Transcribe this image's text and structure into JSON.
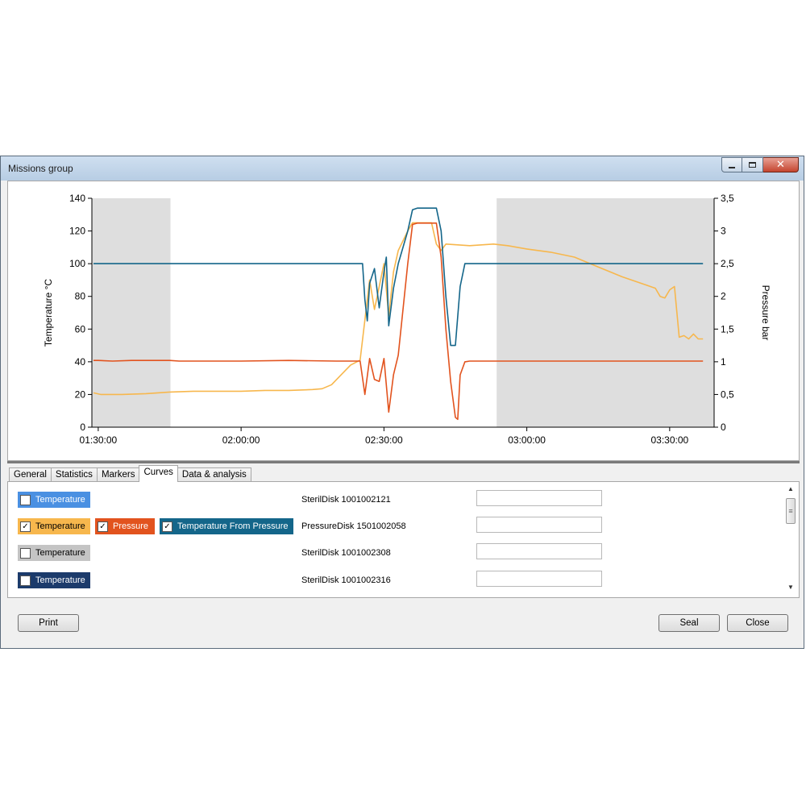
{
  "window": {
    "title": "Missions group"
  },
  "tabs": [
    "General",
    "Statistics",
    "Markers",
    "Curves",
    "Data & analysis"
  ],
  "active_tab": "Curves",
  "curve_rows": [
    {
      "curves": [
        {
          "label": "Temperature",
          "checked": false,
          "color": "#4a90e2"
        }
      ],
      "disk": "SterilDisk 1001002121",
      "value": ""
    },
    {
      "curves": [
        {
          "label": "Temperature",
          "checked": true,
          "color": "#f7b74d"
        },
        {
          "label": "Pressure",
          "checked": true,
          "color": "#e2531e"
        },
        {
          "label": "Temperature From Pressure",
          "checked": true,
          "color": "#14668a"
        }
      ],
      "disk": "PressureDisk 1501002058",
      "value": ""
    },
    {
      "curves": [
        {
          "label": "Temperature",
          "checked": false,
          "color": "#c4c4c4"
        }
      ],
      "disk": "SterilDisk 1001002308",
      "value": ""
    },
    {
      "curves": [
        {
          "label": "Temperature",
          "checked": false,
          "color": "#1c3b6b"
        }
      ],
      "disk": "SterilDisk 1001002316",
      "value": ""
    }
  ],
  "buttons": {
    "print": "Print",
    "seal": "Seal",
    "close": "Close"
  },
  "chart_data": {
    "type": "line",
    "title": "",
    "ylabel": "Temperature °C",
    "y2label": "Pressure bar",
    "x_ticks": [
      "01:30:00",
      "02:00:00",
      "02:30:00",
      "03:00:00",
      "03:30:00"
    ],
    "x_range": [
      "01:28:40",
      "03:39:20"
    ],
    "ylim": [
      0,
      140
    ],
    "y_ticks": [
      "0",
      "20",
      "40",
      "60",
      "80",
      "100",
      "120",
      "140"
    ],
    "y2lim": [
      0,
      3.5
    ],
    "y2_ticks": [
      "0",
      "0,5",
      "1",
      "1,5",
      "2",
      "2,5",
      "3",
      "3,5"
    ],
    "shaded_regions": [
      [
        "01:28:40",
        "01:45:10"
      ],
      [
        "02:53:40",
        "03:39:20"
      ]
    ],
    "series": [
      {
        "name": "Temperature",
        "color": "#f7b74d",
        "axis": "left",
        "points": [
          [
            "01:29:00",
            21
          ],
          [
            "01:30:30",
            20
          ],
          [
            "01:35:00",
            20
          ],
          [
            "01:40:00",
            20.5
          ],
          [
            "01:45:00",
            21.5
          ],
          [
            "01:50:00",
            22
          ],
          [
            "01:55:00",
            22
          ],
          [
            "02:00:00",
            22
          ],
          [
            "02:05:00",
            22.5
          ],
          [
            "02:10:00",
            22.5
          ],
          [
            "02:15:00",
            23
          ],
          [
            "02:17:00",
            23.5
          ],
          [
            "02:19:00",
            26
          ],
          [
            "02:21:00",
            32
          ],
          [
            "02:23:00",
            38
          ],
          [
            "02:25:00",
            41
          ],
          [
            "02:27:00",
            90
          ],
          [
            "02:28:00",
            72
          ],
          [
            "02:30:00",
            100
          ],
          [
            "02:31:00",
            68
          ],
          [
            "02:32:00",
            95
          ],
          [
            "02:33:00",
            108
          ],
          [
            "02:35:00",
            120
          ],
          [
            "02:36:00",
            125
          ],
          [
            "02:40:00",
            125
          ],
          [
            "02:41:00",
            112
          ],
          [
            "02:42:00",
            108
          ],
          [
            "02:43:00",
            112
          ],
          [
            "02:48:00",
            111
          ],
          [
            "02:53:00",
            112
          ],
          [
            "02:56:00",
            111
          ],
          [
            "03:00:00",
            109
          ],
          [
            "03:05:00",
            107
          ],
          [
            "03:10:00",
            104
          ],
          [
            "03:15:00",
            98
          ],
          [
            "03:20:00",
            92
          ],
          [
            "03:25:00",
            87
          ],
          [
            "03:27:00",
            85
          ],
          [
            "03:28:00",
            80
          ],
          [
            "03:29:00",
            79
          ],
          [
            "03:30:00",
            84
          ],
          [
            "03:31:00",
            86
          ],
          [
            "03:32:00",
            55
          ],
          [
            "03:33:00",
            56
          ],
          [
            "03:34:00",
            54
          ],
          [
            "03:35:00",
            57
          ],
          [
            "03:36:00",
            54
          ],
          [
            "03:37:00",
            54
          ]
        ]
      },
      {
        "name": "Pressure",
        "color": "#e2531e",
        "axis": "right",
        "points": [
          [
            "01:29:00",
            1.02
          ],
          [
            "01:30:00",
            1.02
          ],
          [
            "01:33:00",
            1.01
          ],
          [
            "01:37:00",
            1.02
          ],
          [
            "01:40:00",
            1.02
          ],
          [
            "01:45:00",
            1.02
          ],
          [
            "01:47:00",
            1.01
          ],
          [
            "02:00:00",
            1.01
          ],
          [
            "02:10:00",
            1.02
          ],
          [
            "02:20:00",
            1.01
          ],
          [
            "02:25:00",
            1.01
          ],
          [
            "02:26:00",
            0.5
          ],
          [
            "02:27:00",
            1.05
          ],
          [
            "02:28:00",
            0.73
          ],
          [
            "02:29:00",
            0.7
          ],
          [
            "02:30:00",
            1.05
          ],
          [
            "02:31:00",
            0.23
          ],
          [
            "02:32:00",
            0.8
          ],
          [
            "02:33:00",
            1.1
          ],
          [
            "02:35:00",
            2.5
          ],
          [
            "02:36:00",
            3.1
          ],
          [
            "02:37:00",
            3.12
          ],
          [
            "02:40:00",
            3.12
          ],
          [
            "02:41:00",
            3.12
          ],
          [
            "02:42:00",
            2.6
          ],
          [
            "02:43:00",
            1.5
          ],
          [
            "02:44:00",
            0.7
          ],
          [
            "02:45:00",
            0.15
          ],
          [
            "02:45:30",
            0.12
          ],
          [
            "02:46:00",
            0.8
          ],
          [
            "02:47:00",
            1.0
          ],
          [
            "02:48:00",
            1.01
          ],
          [
            "02:53:00",
            1.01
          ],
          [
            "03:00:00",
            1.01
          ],
          [
            "03:10:00",
            1.01
          ],
          [
            "03:20:00",
            1.01
          ],
          [
            "03:30:00",
            1.01
          ],
          [
            "03:37:00",
            1.01
          ]
        ]
      },
      {
        "name": "Temperature From Pressure",
        "color": "#14668a",
        "axis": "left",
        "points": [
          [
            "01:29:00",
            100
          ],
          [
            "02:00:00",
            100
          ],
          [
            "02:25:00",
            100
          ],
          [
            "02:25:30",
            100
          ],
          [
            "02:26:00",
            78
          ],
          [
            "02:26:30",
            65
          ],
          [
            "02:27:00",
            88
          ],
          [
            "02:28:00",
            97
          ],
          [
            "02:29:00",
            73
          ],
          [
            "02:30:00",
            95
          ],
          [
            "02:30:30",
            104
          ],
          [
            "02:31:00",
            62
          ],
          [
            "02:32:00",
            85
          ],
          [
            "02:33:00",
            100
          ],
          [
            "02:35:00",
            120
          ],
          [
            "02:36:00",
            133
          ],
          [
            "02:37:00",
            134
          ],
          [
            "02:40:00",
            134
          ],
          [
            "02:41:00",
            134
          ],
          [
            "02:42:00",
            120
          ],
          [
            "02:43:00",
            80
          ],
          [
            "02:44:00",
            50
          ],
          [
            "02:45:00",
            50
          ],
          [
            "02:46:00",
            86
          ],
          [
            "02:47:00",
            100
          ],
          [
            "02:53:00",
            100
          ],
          [
            "03:00:00",
            100
          ],
          [
            "03:20:00",
            100
          ],
          [
            "03:37:00",
            100
          ]
        ]
      }
    ]
  }
}
